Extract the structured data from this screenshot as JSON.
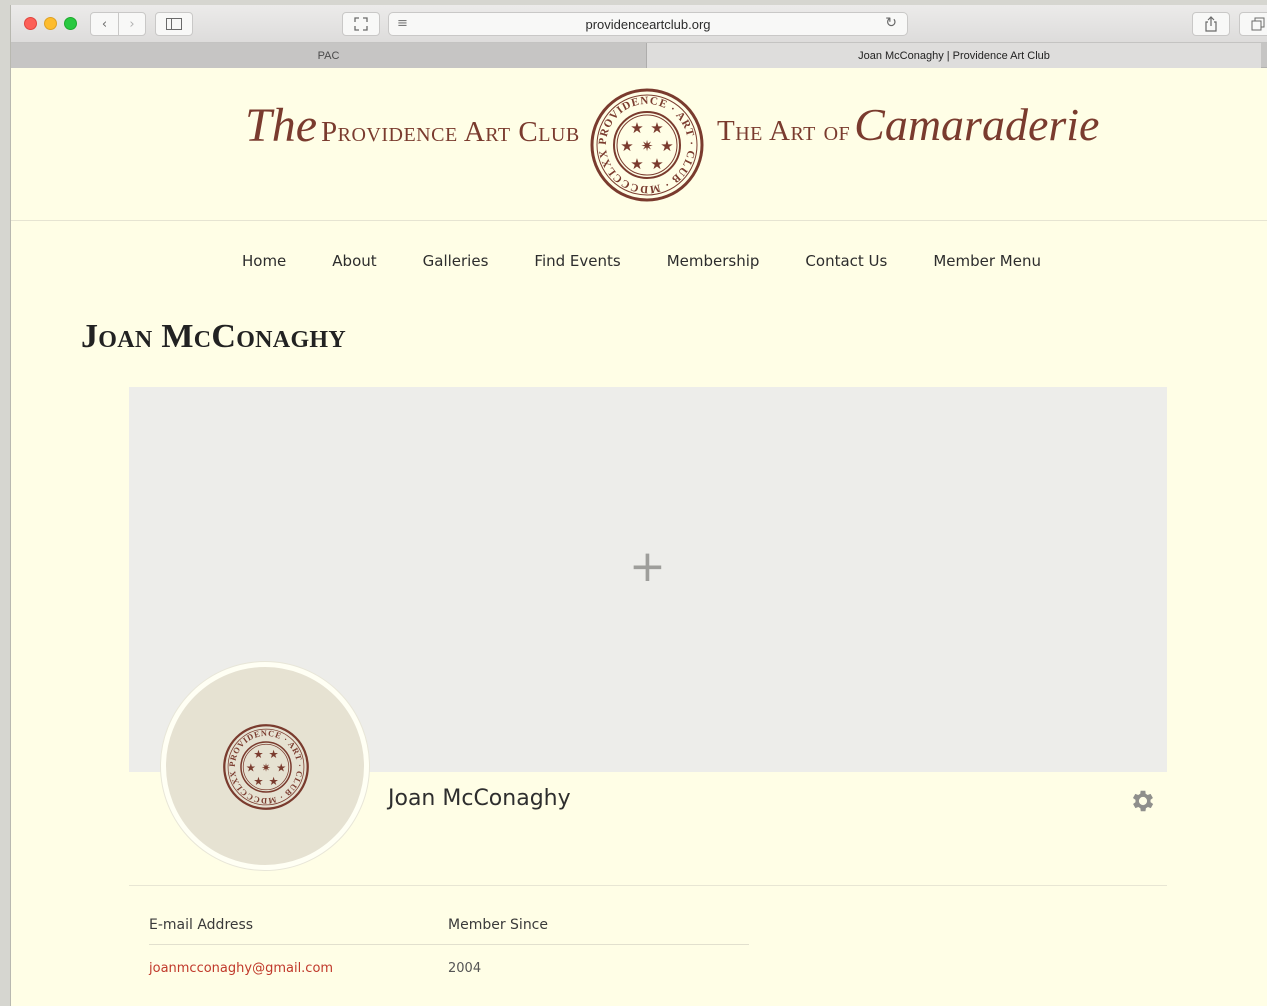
{
  "browser": {
    "url": "providenceartclub.org",
    "tabs": [
      {
        "label": "PAC",
        "active": false
      },
      {
        "label": "Joan McConaghy | Providence Art Club",
        "active": true
      }
    ]
  },
  "site": {
    "brand_left_the": "The",
    "brand_left_rest": "Providence Art Club",
    "brand_right_rest": "The Art of",
    "brand_right_script": "Camaraderie",
    "seal_text": "PROVIDENCE · ART · CLUB · MDCCCLXXX",
    "brand_color": "#7a3b2e"
  },
  "nav": {
    "items": [
      "Home",
      "About",
      "Galleries",
      "Find Events",
      "Membership",
      "Contact Us",
      "Member Menu"
    ]
  },
  "profile": {
    "page_title": "Joan McConaghy",
    "display_name": "Joan McConaghy",
    "cover_add_icon": "plus-icon",
    "settings_icon": "gear-icon",
    "fields": {
      "email_label": "E-mail Address",
      "email_value": "joanmcconaghy@gmail.com",
      "since_label": "Member Since",
      "since_value": "2004"
    }
  },
  "colors": {
    "page_background": "#fffee6",
    "link": "#c0392b"
  }
}
